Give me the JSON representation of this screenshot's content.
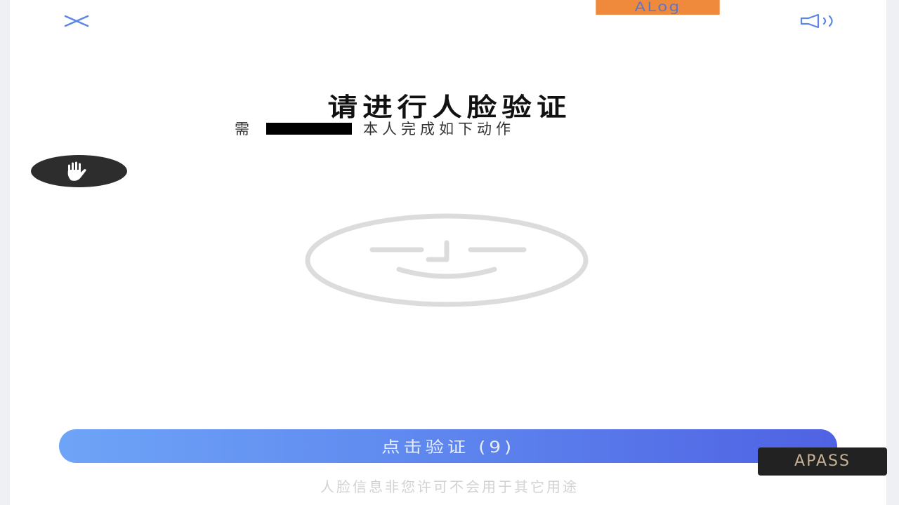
{
  "header": {
    "close_icon": "close-icon",
    "alog_label": "ALog",
    "speaker_icon": "speaker-icon"
  },
  "main": {
    "title": "请进行人脸验证",
    "subtitle_prefix": "需",
    "subtitle_suffix": "本人完成如下动作",
    "action_icon": "hand-wave-icon",
    "face_icon": "face-outline-icon"
  },
  "footer": {
    "verify_button_label": "点击验证 (9)",
    "privacy_text": "人脸信息非您许可不会用于其它用途"
  },
  "overlay": {
    "apass_label": "APASS"
  },
  "colors": {
    "accent": "#5f89ef",
    "alog_bg": "#ef8a3c",
    "face_gray": "#dcdcdc"
  }
}
